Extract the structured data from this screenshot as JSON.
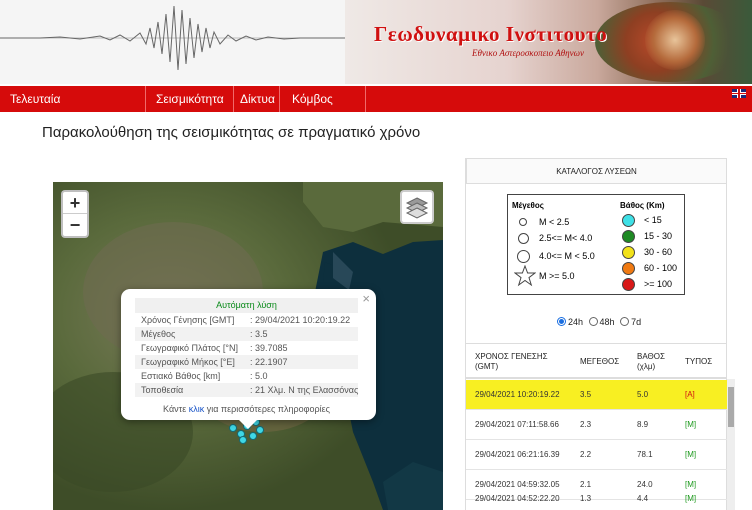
{
  "header": {
    "title": "Γεωδυναμικο Ινστιτουτο",
    "subtitle": "Εθνικο Αστεροσκοπειο Αθηνων"
  },
  "nav": {
    "items": [
      {
        "label": "Τελευταία Ανακοινωθέντα"
      },
      {
        "label": "Σεισμικότητα"
      },
      {
        "label": "Δίκτυα"
      },
      {
        "label": "Κόμβος EIDA"
      }
    ],
    "language_flag": "uk-flag-icon"
  },
  "page": {
    "title": "Παρακολούθηση της σεισμικότητας σε πραγματικό χρόνο"
  },
  "map": {
    "zoom_in": "+",
    "zoom_out": "−",
    "layers_icon": "layers-icon",
    "popup": {
      "close": "×",
      "title": "Αυτόματη λύση",
      "rows": [
        {
          "key": "Χρόνος Γένησης [GMT]",
          "value": ": 29/04/2021 10:20:19.22"
        },
        {
          "key": "Μέγεθος",
          "value": ": 3.5"
        },
        {
          "key": "Γεωγραφικό Πλάτος [°N]",
          "value": ": 39.7085"
        },
        {
          "key": "Γεωγραφικό Μήκος [°E]",
          "value": ": 22.1907"
        },
        {
          "key": "Εστιακό Βάθος [km]",
          "value": ": 5.0"
        },
        {
          "key": "Τοποθεσία",
          "value": ": 21 Χλμ. Ν της Ελασσόνας"
        }
      ],
      "footer_pre": "Κάντε ",
      "footer_link": "κλικ",
      "footer_post": " για περισσότερες πληροφορίες"
    }
  },
  "panel": {
    "heading": "ΚΑΤΑΛΟΓΟΣ ΛΥΣΕΩΝ",
    "legend": {
      "magnitude_title": "Μέγεθος",
      "magnitude_items": [
        "M < 2.5",
        "2.5<= M< 4.0",
        "4.0<= M < 5.0",
        "M >= 5.0"
      ],
      "depth_title": "Βάθος (Km)",
      "depth_items": [
        {
          "label": "< 15",
          "color": "#3ee0e6"
        },
        {
          "label": "15 - 30",
          "color": "#1e8a24"
        },
        {
          "label": "30 - 60",
          "color": "#f2e21a"
        },
        {
          "label": "60 - 100",
          "color": "#f07a12"
        },
        {
          "label": ">= 100",
          "color": "#d81818"
        }
      ]
    },
    "range_options": [
      {
        "label": "24h",
        "selected": true
      },
      {
        "label": "48h",
        "selected": false
      },
      {
        "label": "7d",
        "selected": false
      }
    ],
    "table": {
      "columns": [
        "ΧΡΟΝΟΣ ΓΕΝΕΣΗΣ (GMT)",
        "ΜΕΓΕΘΟΣ",
        "ΒΑΘΟΣ (χλμ)",
        "ΤΥΠΟΣ"
      ],
      "rows": [
        {
          "time": "29/04/2021 10:20:19.22",
          "mag": "3.5",
          "depth": "5.0",
          "type": "[A]"
        },
        {
          "time": "29/04/2021 07:11:58.66",
          "mag": "2.3",
          "depth": "8.9",
          "type": "[M]"
        },
        {
          "time": "29/04/2021 06:21:16.39",
          "mag": "2.2",
          "depth": "78.1",
          "type": "[M]"
        },
        {
          "time": "29/04/2021 04:59:32.05",
          "mag": "2.1",
          "depth": "24.0",
          "type": "[M]"
        },
        {
          "time": "29/04/2021 04:52:22.20",
          "mag": "1.3",
          "depth": "4.4",
          "type": "[M]"
        }
      ]
    }
  }
}
